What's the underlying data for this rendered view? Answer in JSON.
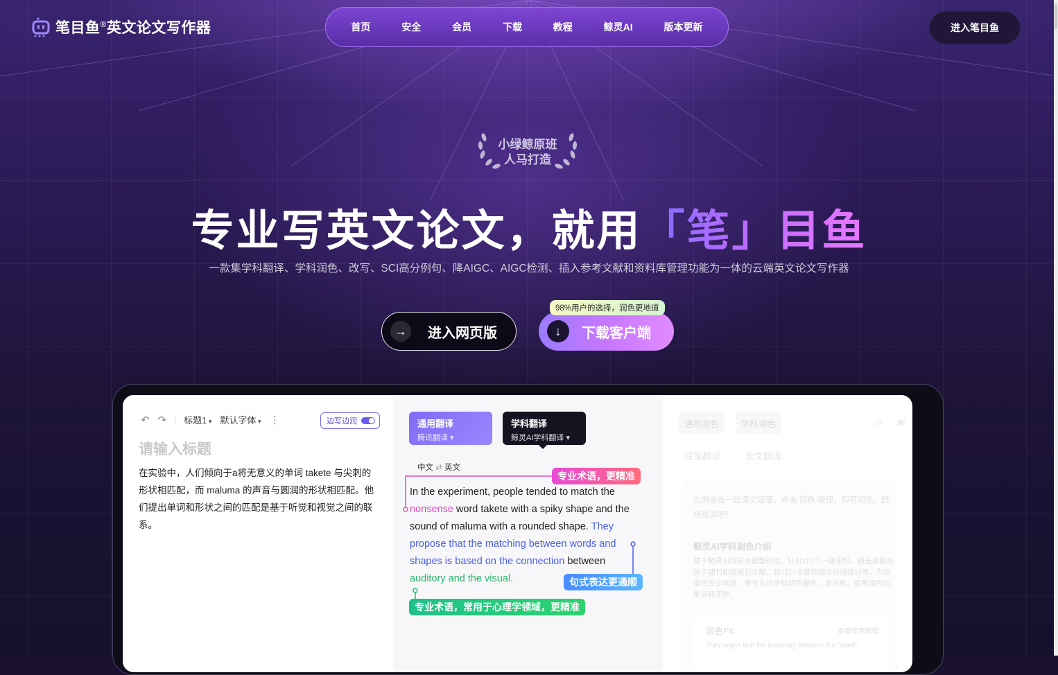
{
  "header": {
    "logo_text": "笔目鱼",
    "logo_reg": "®",
    "logo_suffix": "英文论文写作器",
    "nav": [
      "首页",
      "安全",
      "会员",
      "下载",
      "教程",
      "鲸灵AI",
      "版本更新"
    ],
    "enter_button": "进入笔目鱼"
  },
  "hero": {
    "badge_line1": "小绿鲸原班",
    "badge_line2": "人马打造",
    "title_main": "专业写英文论文，就用",
    "title_highlight": "「笔」目鱼",
    "subtitle": "一款集学科翻译、学科润色、改写、SCI高分例句、降AIGC、AIGC检测、插入参考文献和资料库管理功能为一体的云端英文论文写作器",
    "web_button": "进入网页版",
    "download_button": "下载客户端",
    "download_tip": "98%用户的选择，润色更地道"
  },
  "editor": {
    "heading_dropdown": "标题1",
    "font_dropdown": "默认字体",
    "edge_toggle": "边写边润",
    "title_placeholder": "请输入标题",
    "body": "在实验中，人们倾向于a将无意义的单词 takete 与尖刺的形状相匹配，而 maluma 的声音与圆润的形状相匹配。他们提出单词和形状之间的匹配是基于听觉和视觉之间的联系。"
  },
  "translate": {
    "general_title": "通用翻译",
    "general_sub": "腾讯翻译",
    "subject_title": "学科翻译",
    "subject_sub": "鲸灵AI学科翻译",
    "lang_from": "中文",
    "lang_to": "英文",
    "text_1": "In the experiment, people tended to match the ",
    "text_pink": "nonsense",
    "text_2": " word takete with a spiky shape and the sound of maluma with a rounded shape. ",
    "text_blue": "They propose that the matching between words and shapes is based on the connection",
    "text_3": " between ",
    "text_green": "auditory and the visual.",
    "tag_pink": "专业术语，更精准",
    "tag_blue": "句式表达更通顺",
    "tag_green": "专业术语，常用于心理学领域，更精准"
  },
  "polish": {
    "tab_general": "通用润色",
    "tab_subject": "学科润色",
    "sub_paragraph": "段落翻译",
    "sub_full": "全文翻译",
    "hint": "左侧点击一段译文段落，点击 润色 按钮，即可润色，赶快试试吧！",
    "intro_title": "鲸灵AI学科润色介绍",
    "intro_text": "基于鲸灵AI科研大模型研发，针对113个一级学科，精选高影响因子期刊和高被引文献，超1亿+文献数据进行持续训练。为您提供专业地道、更专业的学科润色服务。请注意，使用润色功能消耗字数。",
    "pk_title": "润色PK",
    "pk_link": "查看使用教程",
    "pk_text": "They argue that the matching between the \"word\""
  }
}
